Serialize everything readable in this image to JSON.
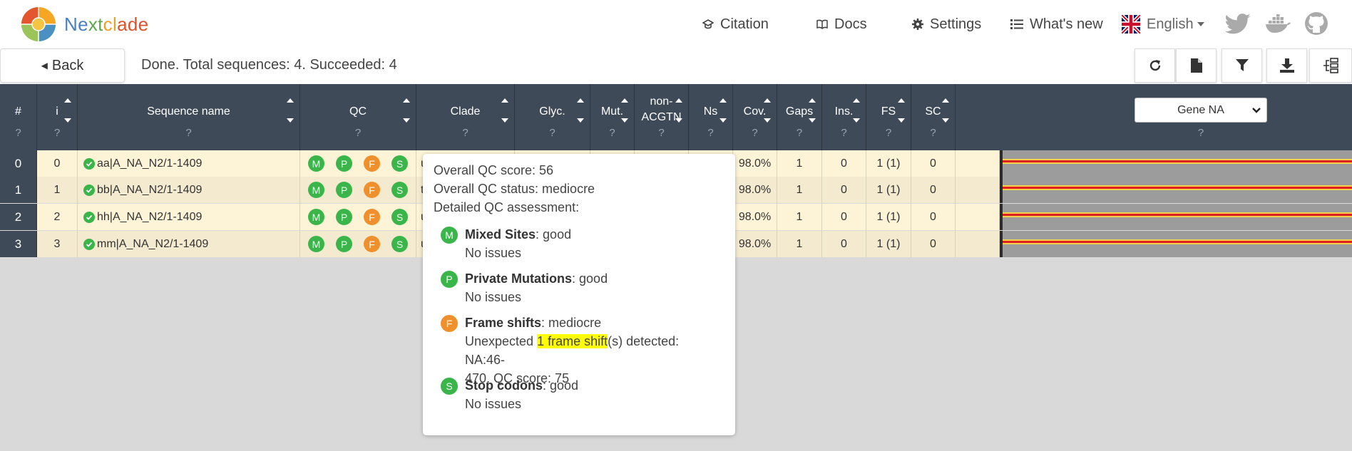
{
  "brand": {
    "name": "Nextclade"
  },
  "nav": {
    "citation": "Citation",
    "docs": "Docs",
    "settings": "Settings",
    "whats_new": "What's new",
    "language": "English",
    "icons": [
      "twitter-icon",
      "docker-icon",
      "github-icon"
    ]
  },
  "toolbar": {
    "back_label": "Back",
    "status": "Done. Total sequences: 4. Succeeded: 4",
    "buttons": [
      "refresh-icon",
      "file-icon",
      "filter-icon",
      "download-icon",
      "tree-icon"
    ]
  },
  "table": {
    "columns": [
      {
        "label": "#",
        "help": "?"
      },
      {
        "label": "i",
        "help": "?"
      },
      {
        "label": "Sequence name",
        "help": "?"
      },
      {
        "label": "QC",
        "help": "?"
      },
      {
        "label": "Clade",
        "help": "?"
      },
      {
        "label": "Glyc.",
        "help": "?"
      },
      {
        "label": "Mut.",
        "help": "?"
      },
      {
        "label": "non-ACGTN",
        "label_line1": "non-",
        "label_line2": "ACGTN",
        "help": "?"
      },
      {
        "label": "Ns",
        "help": "?"
      },
      {
        "label": "Cov.",
        "help": "?"
      },
      {
        "label": "Gaps",
        "help": "?"
      },
      {
        "label": "Ins.",
        "help": "?"
      },
      {
        "label": "FS",
        "help": "?"
      },
      {
        "label": "SC",
        "help": "?"
      }
    ],
    "gene_select": {
      "value": "Gene NA",
      "help": "?"
    },
    "rows": [
      {
        "idx": "0",
        "i": "0",
        "name": "aa|A_NA_N2/1-1409",
        "clade_partial": "u",
        "cov": "98.0%",
        "gaps": "1",
        "ins": "0",
        "fs": "1 (1)",
        "sc": "0"
      },
      {
        "idx": "1",
        "i": "1",
        "name": "bb|A_NA_N2/1-1409",
        "clade_partial": "t",
        "cov": "98.0%",
        "gaps": "1",
        "ins": "0",
        "fs": "1 (1)",
        "sc": "0"
      },
      {
        "idx": "2",
        "i": "2",
        "name": "hh|A_NA_N2/1-1409",
        "clade_partial": "u",
        "cov": "98.0%",
        "gaps": "1",
        "ins": "0",
        "fs": "1 (1)",
        "sc": "0"
      },
      {
        "idx": "3",
        "i": "3",
        "name": "mm|A_NA_N2/1-1409",
        "clade_partial": "u",
        "cov": "98.0%",
        "gaps": "1",
        "ins": "0",
        "fs": "1 (1)",
        "sc": "0"
      }
    ],
    "qc_badges": [
      "M",
      "P",
      "F",
      "S"
    ]
  },
  "tooltip": {
    "score": "Overall QC score: 56",
    "status": "Overall QC status: mediocre",
    "detailed": "Detailed QC assessment:",
    "items": [
      {
        "badge": "M",
        "title": "Mixed Sites",
        "status": ": good",
        "detail": "No issues"
      },
      {
        "badge": "P",
        "title": "Private Mutations",
        "status": ": good",
        "detail": "No issues"
      },
      {
        "badge": "F",
        "title": "Frame shifts",
        "status": ": mediocre",
        "detail_pre": "Unexpected ",
        "detail_hl": "1 frame shift",
        "detail_post1": "(s) detected: NA:46-",
        "detail_post2": "470. QC score: 75"
      },
      {
        "badge": "S",
        "title": "Stop codons",
        "status": ": good",
        "detail": "No issues"
      }
    ]
  },
  "colors": {
    "header_bg": "#3e4a57",
    "row_bg_odd": "#fdf3d6",
    "row_bg_even": "#f4ead0",
    "qc_good": "#3ab54a",
    "qc_mediocre": "#f0902c",
    "highlight": "#ffff00"
  }
}
